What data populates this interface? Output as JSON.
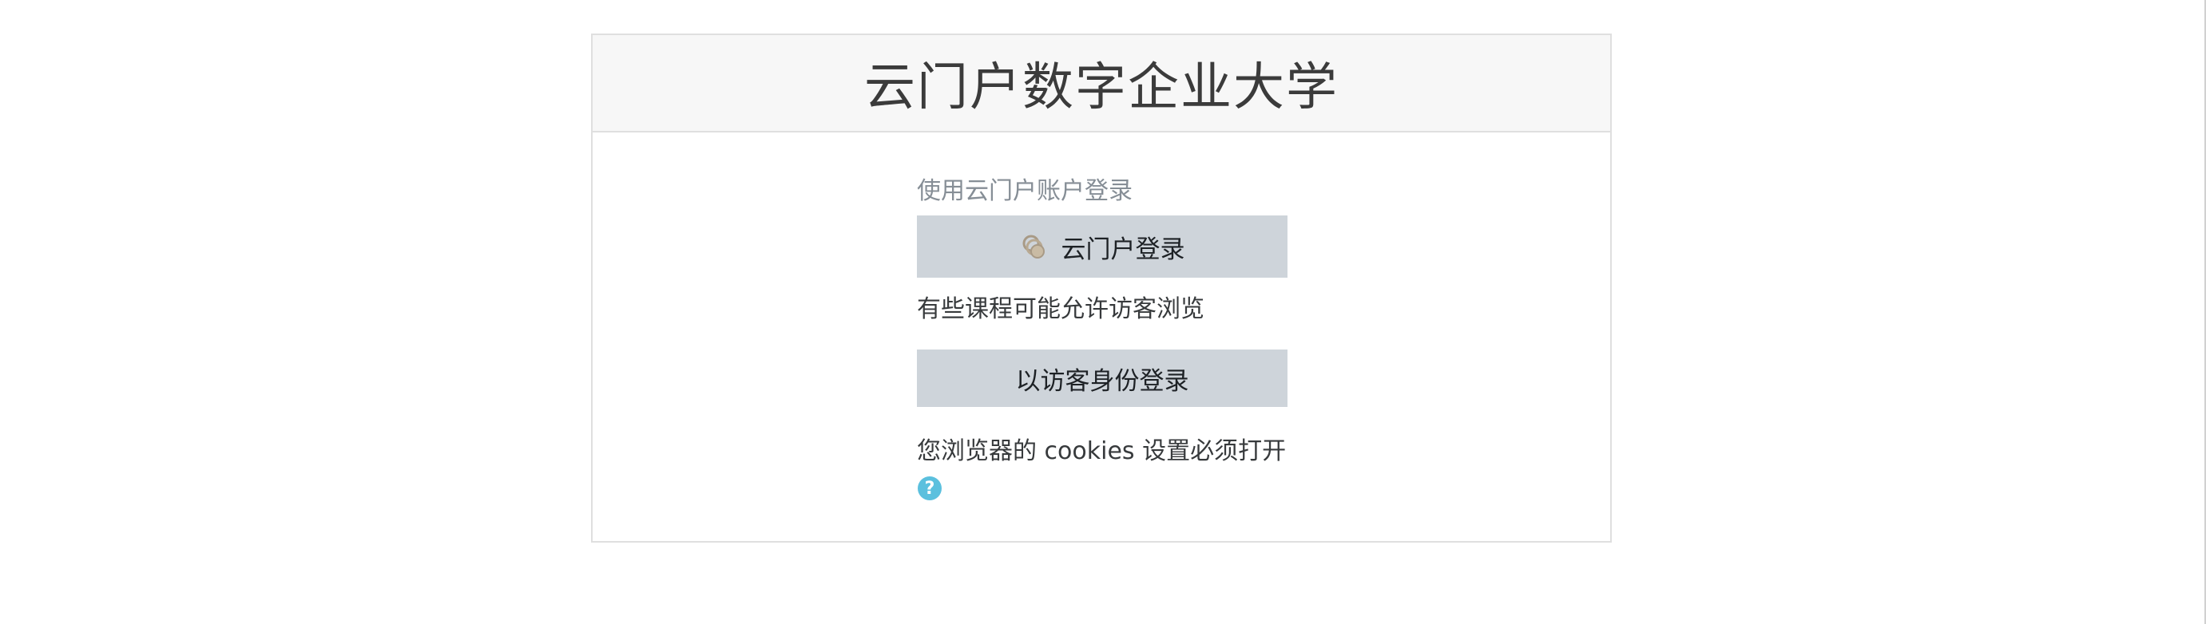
{
  "site": {
    "title": "云门户数字企业大学"
  },
  "login": {
    "oauth_heading": "使用云门户账户登录",
    "oauth_button_label": "云门户登录",
    "guest_note": "有些课程可能允许访客浏览",
    "guest_button_label": "以访客身份登录",
    "cookies_note": "您浏览器的 cookies 设置必须打开"
  },
  "icons": {
    "portal": "portal-logo-icon",
    "help": "question-circle-icon"
  },
  "colors": {
    "button_bg": "#ced4da",
    "header_bg": "#f7f7f7",
    "help_icon": "#5bc0de"
  }
}
